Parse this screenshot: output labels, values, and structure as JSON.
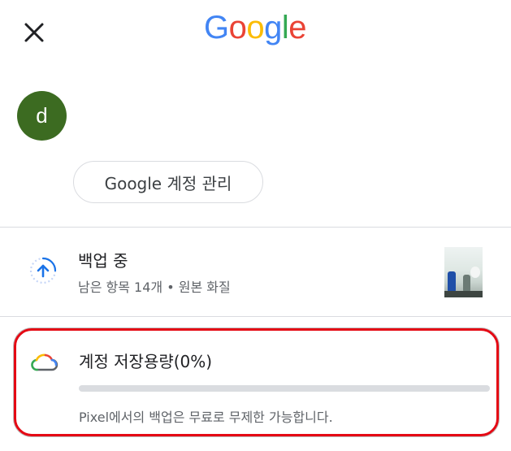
{
  "header": {
    "close_icon": "close-icon",
    "logo_text": [
      "G",
      "o",
      "o",
      "g",
      "l",
      "e"
    ]
  },
  "account": {
    "avatar_letter": "d",
    "avatar_color": "#3c6b21",
    "manage_label": "Google 계정 관리"
  },
  "backup": {
    "icon": "backup-upload-icon",
    "title": "백업 중",
    "subtitle": "남은 항목 14개 • 원본 화질"
  },
  "storage": {
    "icon": "google-cloud-icon",
    "title": "계정 저장용량(0%)",
    "progress": 0,
    "subtitle": "Pixel에서의 백업은 무료로 무제한 가능합니다."
  }
}
